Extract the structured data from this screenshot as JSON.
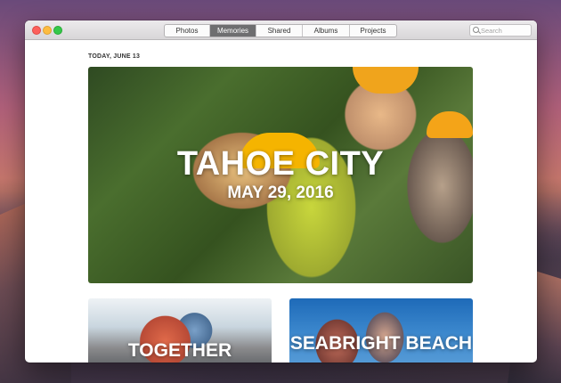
{
  "window": {
    "tabs": [
      {
        "label": "Photos",
        "active": false
      },
      {
        "label": "Memories",
        "active": true
      },
      {
        "label": "Shared",
        "active": false
      },
      {
        "label": "Albums",
        "active": false
      },
      {
        "label": "Projects",
        "active": false
      }
    ],
    "search": {
      "placeholder": "Search"
    }
  },
  "memories": {
    "date_header": "TODAY, JUNE 13",
    "hero": {
      "title": "TAHOE CITY",
      "date": "MAY 29, 2016"
    },
    "cards": [
      {
        "title": "TOGETHER"
      },
      {
        "title": "SEABRIGHT BEACH"
      }
    ]
  },
  "colors": {
    "active_tab": "#6e6e70",
    "close": "#fc605c",
    "minimize": "#fdbc40",
    "maximize": "#34c84a"
  }
}
